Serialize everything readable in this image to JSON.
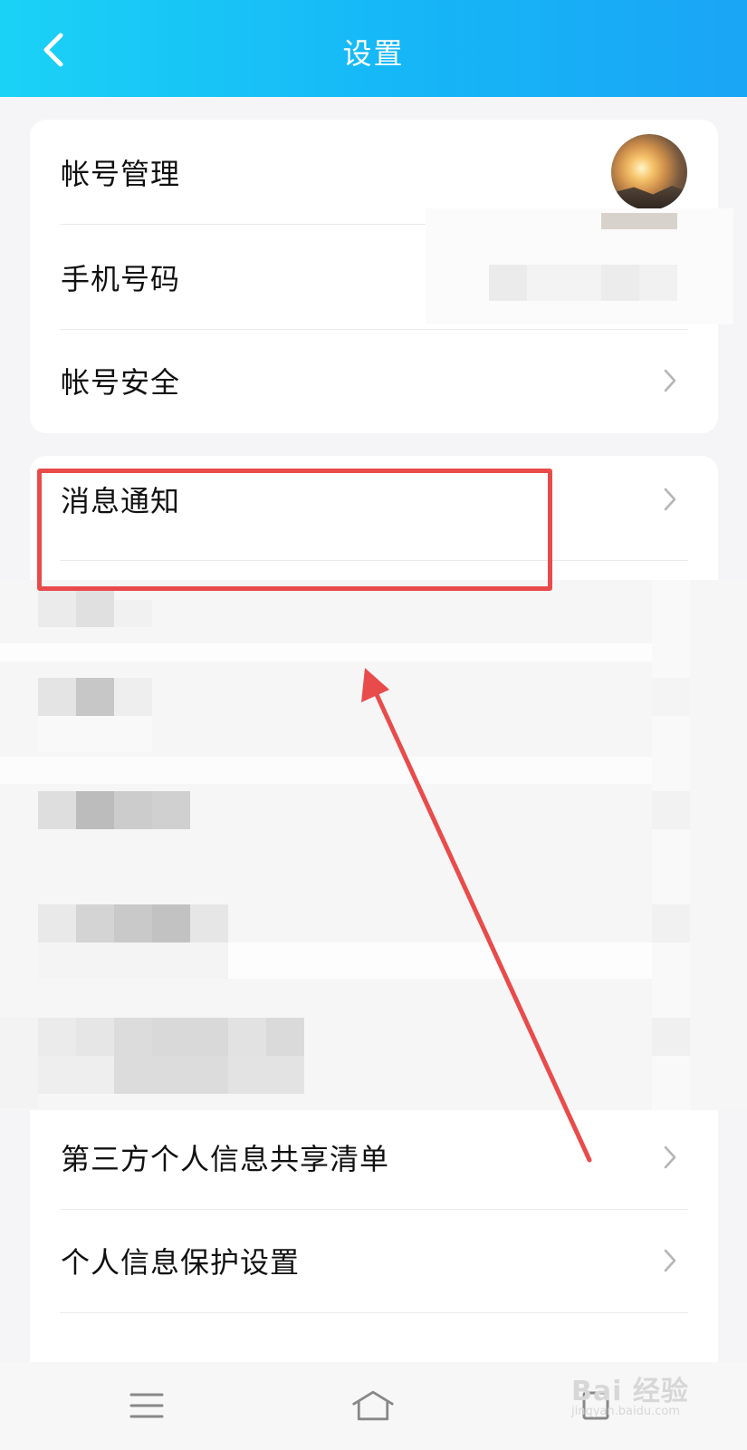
{
  "header": {
    "title": "设置",
    "background_start": "#1ad2f6",
    "background_end": "#1aa5f5"
  },
  "card1": {
    "items": [
      {
        "label": "帐号管理",
        "trailing": "avatar"
      },
      {
        "label": "手机号码",
        "trailing": "redacted-value"
      },
      {
        "label": "帐号安全",
        "trailing": "chevron-right-icon"
      }
    ]
  },
  "card2": {
    "items": [
      {
        "label": "消息通知",
        "trailing": "chevron-right-icon",
        "highlighted": true
      },
      {
        "label": "第三方个人信息共享清单",
        "trailing": "chevron-right-icon"
      },
      {
        "label": "个人信息保护设置",
        "trailing": "chevron-right-icon"
      }
    ]
  },
  "annotation": {
    "highlight_color": "#e94b4b",
    "arrow_color": "#e94b4b"
  },
  "bottom_nav": {
    "buttons": [
      "menu-icon",
      "home-icon",
      "back-icon"
    ]
  },
  "watermark": {
    "logo": "Bai 经验",
    "url": "jingyan.baidu.com"
  }
}
